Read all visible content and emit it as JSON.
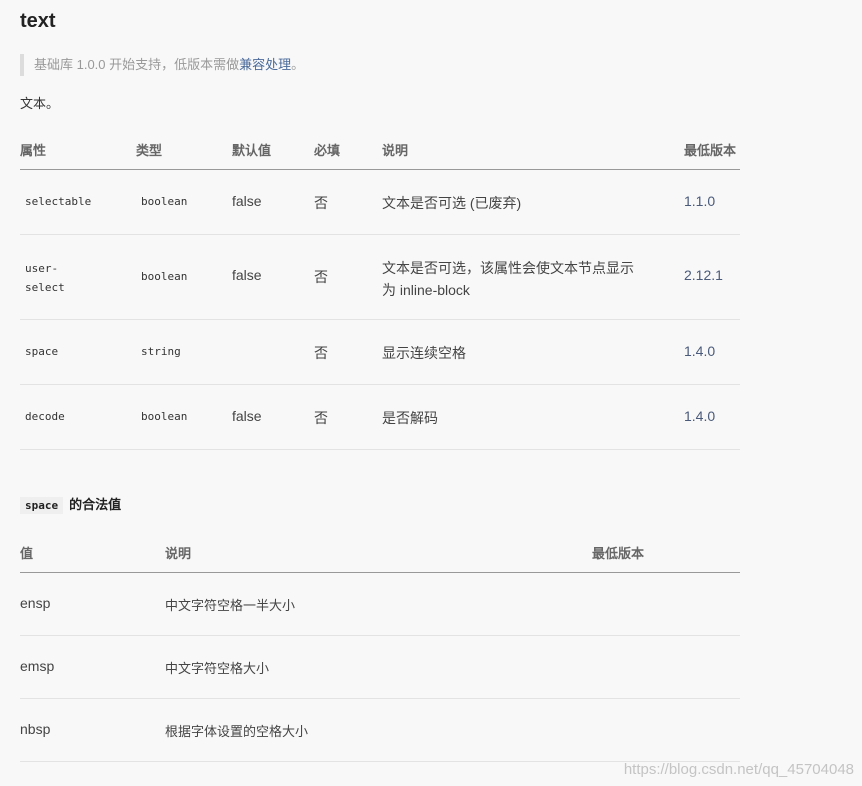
{
  "title": "text",
  "note": {
    "prefix": "基础库 1.0.0 开始支持，低版本需做",
    "link": "兼容处理",
    "suffix": "。"
  },
  "description": "文本。",
  "attr_table": {
    "headers": [
      "属性",
      "类型",
      "默认值",
      "必填",
      "说明",
      "最低版本"
    ],
    "rows": [
      {
        "name": "selectable",
        "type": "boolean",
        "default": "false",
        "required": "否",
        "desc": "文本是否可选 (已废弃)",
        "version": "1.1.0"
      },
      {
        "name": "user-select",
        "type": "boolean",
        "default": "false",
        "required": "否",
        "desc": "文本是否可选，该属性会使文本节点显示为 inline-block",
        "version": "2.12.1"
      },
      {
        "name": "space",
        "type": "string",
        "default": "",
        "required": "否",
        "desc": "显示连续空格",
        "version": "1.4.0"
      },
      {
        "name": "decode",
        "type": "boolean",
        "default": "false",
        "required": "否",
        "desc": "是否解码",
        "version": "1.4.0"
      }
    ]
  },
  "space_section": {
    "code": "space",
    "heading": "的合法值"
  },
  "space_table": {
    "headers": [
      "值",
      "说明",
      "最低版本"
    ],
    "rows": [
      {
        "value": "ensp",
        "desc": "中文字符空格一半大小",
        "version": ""
      },
      {
        "value": "emsp",
        "desc": "中文字符空格大小",
        "version": ""
      },
      {
        "value": "nbsp",
        "desc": "根据字体设置的空格大小",
        "version": ""
      }
    ]
  },
  "watermark": "https://blog.csdn.net/qq_45704048"
}
